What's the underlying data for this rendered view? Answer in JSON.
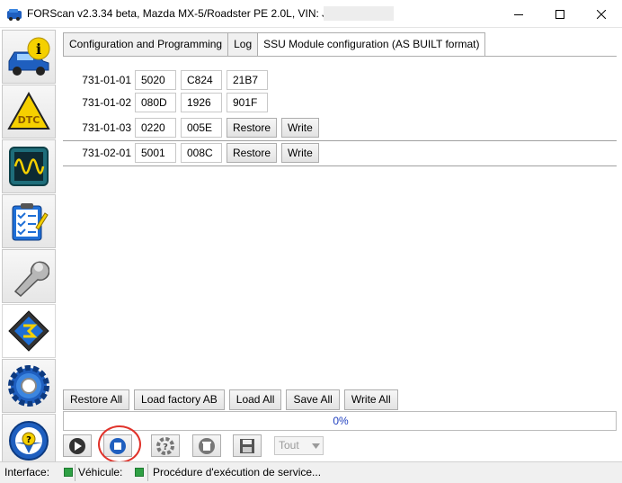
{
  "window": {
    "title": "FORScan v2.3.34 beta, Mazda MX-5/Roadster PE 2.0L, VIN: JMZ"
  },
  "sidebar": {
    "items": [
      {
        "name": "vehicle-info",
        "icon": "info-car-icon"
      },
      {
        "name": "dtc",
        "icon": "dtc-warning-icon"
      },
      {
        "name": "oscilloscope",
        "icon": "oscilloscope-icon"
      },
      {
        "name": "tests",
        "icon": "checklist-icon"
      },
      {
        "name": "service",
        "icon": "wrench-icon"
      },
      {
        "name": "configuration",
        "icon": "chip-icon",
        "active": true
      },
      {
        "name": "settings",
        "icon": "gear-icon"
      },
      {
        "name": "help",
        "icon": "steering-help-icon"
      }
    ]
  },
  "tabs": [
    {
      "label": "Configuration and Programming"
    },
    {
      "label": "Log"
    },
    {
      "label": "SSU Module configuration (AS BUILT format)",
      "active": true
    }
  ],
  "asbuilt": {
    "rows": [
      {
        "id": "731-01-01",
        "values": [
          "5020",
          "C824",
          "21B7"
        ],
        "buttons": []
      },
      {
        "id": "731-01-02",
        "values": [
          "080D",
          "1926",
          "901F"
        ],
        "buttons": []
      },
      {
        "id": "731-01-03",
        "values": [
          "0220",
          "005E"
        ],
        "buttons": [
          "Restore",
          "Write"
        ]
      },
      {
        "id": "731-02-01",
        "values": [
          "5001",
          "008C"
        ],
        "buttons": [
          "Restore",
          "Write"
        ]
      }
    ]
  },
  "actions": {
    "restore_all": "Restore All",
    "load_factory": "Load factory AB",
    "load_all": "Load All",
    "save_all": "Save All",
    "write_all": "Write All"
  },
  "progress": {
    "value": 0,
    "label": "0%"
  },
  "toolbar": {
    "select_value": "Tout",
    "icons": [
      "play-icon",
      "stop-icon",
      "help-lifebuoy-icon",
      "delete-icon",
      "save-icon"
    ]
  },
  "status": {
    "interface_label": "Interface:",
    "vehicle_label": "Véhicule:",
    "message": "Procédure d'exécution de service..."
  },
  "colors": {
    "accent_blue": "#1f5fbf",
    "status_green": "#2fa044",
    "highlight_red": "#e0322a",
    "progress_text": "#1f3fbf"
  }
}
